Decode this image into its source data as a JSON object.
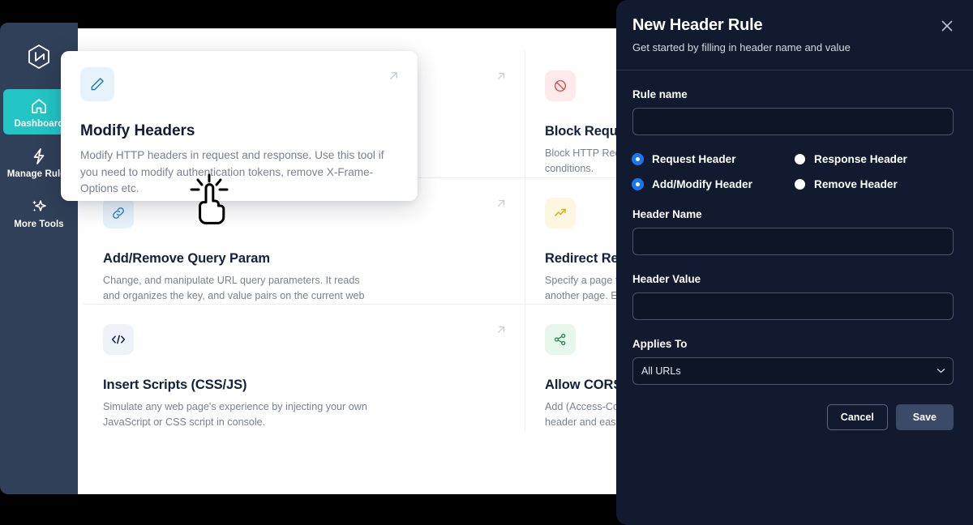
{
  "sidebar": {
    "logo_icon": "hexagon-arrow-logo",
    "items": [
      {
        "label": "Dashboard",
        "icon": "home-icon",
        "active": true
      },
      {
        "label": "Manage Rules",
        "icon": "lightning-icon",
        "active": false
      },
      {
        "label": "More Tools",
        "icon": "sparkles-icon",
        "active": false
      }
    ],
    "active_color": "#23c4c4",
    "background": "#2f4058"
  },
  "popover": {
    "icon": "pencil-icon",
    "arrow_icon": "arrow-up-right-icon",
    "title": "Modify Headers",
    "description": "Modify HTTP headers in request and response. Use this tool if you need to modify authentication tokens, remove X-Frame-Options etc."
  },
  "cursor": {
    "icon": "pointing-hand-click-cursor"
  },
  "tools": [
    {
      "title": "Modify Headers",
      "description": "Modify HTTP headers in request and response. Use this tool if you need to modify authentication tokens, remove X-Frame-Options etc.",
      "icon": "pencil-icon",
      "icon_bg": "#e8f2fb",
      "icon_color": "#1f7fc4"
    },
    {
      "title": "Block Requests",
      "description": "Block HTTP Requests based on your specified URL string conditions.",
      "icon": "block-icon",
      "icon_bg": "#fdeaea",
      "icon_color": "#d94b4b"
    },
    {
      "title": "Add/Remove Query Param",
      "description": "Change, and manipulate URL query parameters. It reads and organizes the key, and value pairs on the current web page.",
      "icon": "link-icon",
      "icon_bg": "#e8f2fb",
      "icon_color": "#1f7fc4"
    },
    {
      "title": "Redirect Requests",
      "description": "Specify a page that should be automatically redirected to another page. E.g. you want http://lambdatest.com/111 to redirect to http://lambdatest.com/222.",
      "icon": "trending-up-icon",
      "icon_bg": "#fdf6e0",
      "icon_color": "#e0a818"
    },
    {
      "title": "Insert Scripts (CSS/JS)",
      "description": "Simulate any web page's experience by injecting your own JavaScript or CSS script in console.",
      "icon": "code-icon",
      "icon_bg": "#eef3fa",
      "icon_color": "#16243f"
    },
    {
      "title": "Allow CORS",
      "description": "Add (Access-Control-Allow-Origin: *) rule to the response header and easily perform cross-domain Ajax requests in web applications.",
      "icon": "share-nodes-icon",
      "icon_bg": "#e8f7ec",
      "icon_color": "#2a8a47"
    }
  ],
  "drawer": {
    "title": "New Header Rule",
    "subtitle": "Get started by filling in header name and value",
    "close_icon": "close-icon",
    "rule_name": {
      "label": "Rule name",
      "value": "",
      "placeholder": ""
    },
    "radios": [
      {
        "label": "Request Header",
        "selected": true
      },
      {
        "label": "Response Header",
        "selected": false
      },
      {
        "label": "Add/Modify Header",
        "selected": true
      },
      {
        "label": "Remove Header",
        "selected": false
      }
    ],
    "header_name": {
      "label": "Header Name",
      "value": "",
      "placeholder": ""
    },
    "header_value": {
      "label": "Header Value",
      "value": "",
      "placeholder": ""
    },
    "applies_to": {
      "label": "Applies To",
      "selected": "All URLs",
      "options": [
        "All URLs"
      ],
      "chevron_icon": "chevron-down-icon"
    },
    "cancel_label": "Cancel",
    "save_label": "Save",
    "background": "#111a2e",
    "accent_color": "#1878ee"
  }
}
